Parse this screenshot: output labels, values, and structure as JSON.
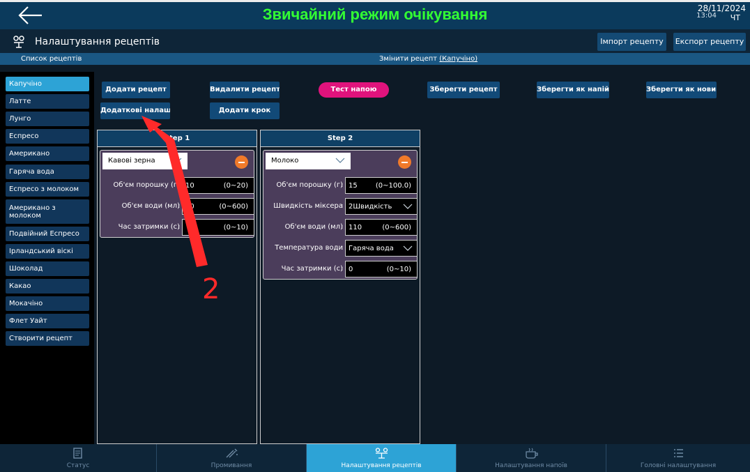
{
  "topbar": {
    "status_title": "Звичайний режим очікування",
    "time": "13:04",
    "date": "28/11/2024",
    "day": "ЧТ"
  },
  "header": {
    "page_title": "Налаштування рецептів",
    "import_label": "Імпорт рецепту",
    "export_label": "Експорт рецепту"
  },
  "subheader": {
    "list_label": "Список рецептів",
    "edit_prefix": "Змінити рецепт ",
    "edit_recipe": "(Капучіно)"
  },
  "sidebar": {
    "items": [
      {
        "label": "Капучіно"
      },
      {
        "label": "Латте"
      },
      {
        "label": "Лунго"
      },
      {
        "label": "Еспресо"
      },
      {
        "label": "Американо"
      },
      {
        "label": "Гаряча вода"
      },
      {
        "label": "Еспресо з молоком"
      },
      {
        "label": "Американо з молоком"
      },
      {
        "label": "Подвійний Еспресо"
      },
      {
        "label": "Ірландський віскі"
      },
      {
        "label": "Шоколад"
      },
      {
        "label": "Какао"
      },
      {
        "label": "Мокачіно"
      },
      {
        "label": "Флет Уайт"
      },
      {
        "label": "Створити рецепт"
      }
    ]
  },
  "actions": {
    "add_recipe": "Додати рецепт",
    "delete_recipe": "Видалити рецепт",
    "test_drink": "Тест напою",
    "save_recipe": "Зберегти рецепт",
    "save_as_drink": "Зберегти як напій",
    "save_as_new": "Зберегти як новий ре",
    "extra_settings": "Додаткові налаштува",
    "add_step": "Додати крок"
  },
  "steps": [
    {
      "title": "Step 1",
      "ingredient": "Кавові зерна",
      "fields": [
        {
          "label": "Об'єм порошку (г)",
          "value": "10",
          "range": "(0~20)"
        },
        {
          "label": "Об'єм води (мл)",
          "value": "70",
          "range": "(0~600)"
        },
        {
          "label": "Час затримки (с)",
          "value": "",
          "range": "(0~10)"
        }
      ]
    },
    {
      "title": "Step 2",
      "ingredient": "Молоко",
      "fields": [
        {
          "label": "Об'єм порошку (г)",
          "value": "15",
          "range": "(0~100.0)"
        },
        {
          "label": "Швидкість міксера",
          "value": "2Швидкість",
          "range": ""
        },
        {
          "label": "Об'єм води (мл)",
          "value": "110",
          "range": "(0~600)"
        },
        {
          "label": "Температура води",
          "value": "Гаряча вода",
          "range": ""
        },
        {
          "label": "Час затримки (с)",
          "value": "0",
          "range": "(0~10)"
        }
      ]
    }
  ],
  "annotation": {
    "number": "2"
  },
  "bottom_tabs": [
    {
      "label": "Статус",
      "icon": "status-icon"
    },
    {
      "label": "Промивання",
      "icon": "rinse-icon"
    },
    {
      "label": "Налаштування рецептів",
      "icon": "recipe-icon"
    },
    {
      "label": "Налаштування напоїв",
      "icon": "cup-icon"
    },
    {
      "label": "Головні налаштування",
      "icon": "list-icon"
    }
  ],
  "colors": {
    "status_green": "#33ff33",
    "accent_blue": "#2da3d6",
    "test_pink": "#e0137c",
    "remove_orange": "#f07a2a",
    "annotation_red": "#ff2a2a"
  }
}
